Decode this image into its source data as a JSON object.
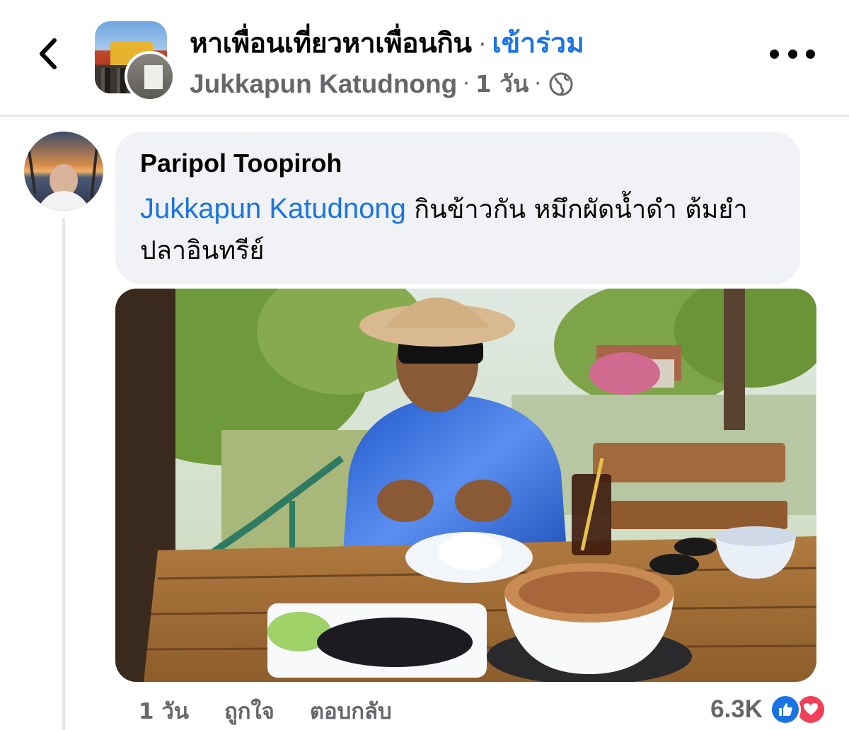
{
  "header": {
    "back_icon": "chevron-left-icon",
    "group_name": "หาเพื่อนเที่ยวหาเพื่อนกิน",
    "separator": "·",
    "join_label": "เข้าร่วม",
    "author": "Jukkapun Katudnong",
    "time": "1 วัน",
    "privacy_icon": "globe-icon",
    "more_icon": "more-dots-icon"
  },
  "comment": {
    "author": "Paripol Toopiroh",
    "mention": "Jukkapun Katudnong",
    "text": " กินข้าวกัน หมึกผัดน้ำดำ ต้มยำปลาอินทรีย์",
    "photo_alt": "photo",
    "time": "1 วัน",
    "like_label": "ถูกใจ",
    "reply_label": "ตอบกลับ",
    "reaction_count": "6.3K",
    "reaction_icons": [
      "like-reaction-icon",
      "love-reaction-icon"
    ]
  },
  "colors": {
    "link_blue": "#1b74e4",
    "secondary_text": "#65676b",
    "bubble_bg": "#f0f2f5",
    "love_red": "#f33e58"
  }
}
